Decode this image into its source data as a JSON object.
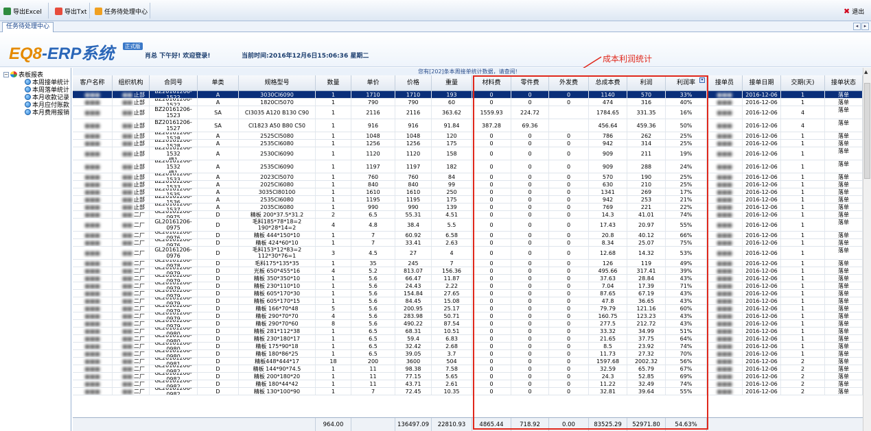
{
  "toolbar": {
    "export_excel": "导出Excel",
    "export_txt": "导出Txt",
    "task_center": "任务待处理中心",
    "exit": "退出"
  },
  "tab": {
    "label": "任务待处理中心"
  },
  "header": {
    "logo_a": "EQ8",
    "logo_b": "-ERP系统",
    "badge": "正式版",
    "greeting": "肖总 下午好! 欢迎登录!",
    "time": "当前时间:2016年12月6日15:06:36 星期二"
  },
  "annotation": "成本利润统计",
  "tree": {
    "root": "表板报表",
    "items": [
      "本周接单统计",
      "本周落单统计",
      "本月收款记录",
      "本月应付账款",
      "本月费用报销"
    ]
  },
  "grid": {
    "info": "您有[202]条本周接单统计数据，请查阅!",
    "columns": [
      "客户名称",
      "组织机构",
      "合同号",
      "单类",
      "规格型号",
      "数量",
      "单价",
      "价格",
      "重量",
      "材料费",
      "零件费",
      "外发费",
      "总成本费",
      "利润",
      "利润率",
      "接单员",
      "接单日期",
      "交期(天)",
      "接单状态"
    ],
    "rows": [
      [
        "",
        "止部",
        "BZ20161206-1522",
        "A",
        "3030CI6090",
        "1",
        "1710",
        "1710",
        "193",
        "0",
        "0",
        "0",
        "1140",
        "570",
        "33%",
        "",
        "2016-12-06",
        "1",
        "落单"
      ],
      [
        "",
        "止部",
        "BZ20161206-1522",
        "A",
        "1820CI5070",
        "1",
        "790",
        "790",
        "60",
        "0",
        "0",
        "0",
        "474",
        "316",
        "40%",
        "",
        "2016-12-06",
        "1",
        "落单"
      ],
      [
        "",
        "止部",
        "BZ20161206-1523",
        "SA",
        "CI3035 A120 B130 C90",
        "1",
        "2116",
        "2116",
        "363.62",
        "1559.93",
        "224.72",
        "",
        "1784.65",
        "331.35",
        "16%",
        "",
        "2016-12-06",
        "4",
        "落单"
      ],
      [
        "",
        "止部",
        "BZ20161206-1527",
        "SA",
        "CI1823 A50 B80 C50",
        "1",
        "916",
        "916",
        "91.84",
        "387.28",
        "69.36",
        "",
        "456.64",
        "459.36",
        "50%",
        "",
        "2016-12-06",
        "4",
        "落单"
      ],
      [
        "",
        "止部",
        "BZ20161206-1528",
        "A",
        "2525CI5080",
        "1",
        "1048",
        "1048",
        "120",
        "0",
        "0",
        "0",
        "786",
        "262",
        "25%",
        "",
        "2016-12-06",
        "1",
        "落单"
      ],
      [
        "",
        "止部",
        "BZ20161206-1528",
        "A",
        "2535CI6080",
        "1",
        "1256",
        "1256",
        "175",
        "0",
        "0",
        "0",
        "942",
        "314",
        "25%",
        "",
        "2016-12-06",
        "1",
        "落单"
      ],
      [
        "",
        "止部",
        "BZ20161206-1532\n修1",
        "A",
        "2530CI6090",
        "1",
        "1120",
        "1120",
        "158",
        "0",
        "0",
        "0",
        "909",
        "211",
        "19%",
        "",
        "2016-12-06",
        "1",
        "落单"
      ],
      [
        "",
        "止部",
        "BZ20161206-1532\n修1",
        "A",
        "2535CI6090",
        "1",
        "1197",
        "1197",
        "182",
        "0",
        "0",
        "0",
        "909",
        "288",
        "24%",
        "",
        "2016-12-06",
        "1",
        "落单"
      ],
      [
        "",
        "止部",
        "BZ20161206-1533",
        "A",
        "2023CI5070",
        "1",
        "760",
        "760",
        "84",
        "0",
        "0",
        "0",
        "570",
        "190",
        "25%",
        "",
        "2016-12-06",
        "1",
        "落单"
      ],
      [
        "",
        "止部",
        "BZ20161206-1533",
        "A",
        "2025CI6080",
        "1",
        "840",
        "840",
        "99",
        "0",
        "0",
        "0",
        "630",
        "210",
        "25%",
        "",
        "2016-12-06",
        "1",
        "落单"
      ],
      [
        "",
        "止部",
        "BZ20161206-1535",
        "A",
        "3035CI80100",
        "1",
        "1610",
        "1610",
        "250",
        "0",
        "0",
        "0",
        "1341",
        "269",
        "17%",
        "",
        "2016-12-06",
        "1",
        "落单"
      ],
      [
        "",
        "止部",
        "BZ20161206-1536",
        "A",
        "2535CI6080",
        "1",
        "1195",
        "1195",
        "175",
        "0",
        "0",
        "0",
        "942",
        "253",
        "21%",
        "",
        "2016-12-06",
        "1",
        "落单"
      ],
      [
        "",
        "止部",
        "BZ20161206-1537",
        "A",
        "2035CI6080",
        "1",
        "990",
        "990",
        "139",
        "0",
        "0",
        "0",
        "769",
        "221",
        "22%",
        "",
        "2016-12-06",
        "1",
        "落单"
      ],
      [
        "",
        "二厂",
        "GL20161206-0975",
        "D",
        "精板 200*37.5*31.2",
        "2",
        "6.5",
        "55.31",
        "4.51",
        "0",
        "0",
        "0",
        "14.3",
        "41.01",
        "74%",
        "",
        "2016-12-06",
        "1",
        "落单"
      ],
      [
        "",
        "二厂",
        "GL20161206-0975",
        "D",
        "毛料185*78*18=2\n190*28*14=2",
        "4",
        "4.8",
        "38.4",
        "5.5",
        "0",
        "0",
        "0",
        "17.43",
        "20.97",
        "55%",
        "",
        "2016-12-06",
        "1",
        "落单"
      ],
      [
        "",
        "二厂",
        "GL20161206-0976",
        "D",
        "精板 444*150*10",
        "1",
        "7",
        "60.92",
        "6.58",
        "0",
        "0",
        "0",
        "20.8",
        "40.12",
        "66%",
        "",
        "2016-12-06",
        "1",
        "落单"
      ],
      [
        "",
        "二厂",
        "GL20161206-0976",
        "D",
        "精板 424*60*10",
        "1",
        "7",
        "33.41",
        "2.63",
        "0",
        "0",
        "0",
        "8.34",
        "25.07",
        "75%",
        "",
        "2016-12-06",
        "1",
        "落单"
      ],
      [
        "",
        "二厂",
        "GL20161206-0976",
        "D",
        "毛料153*12*83=2\n112*30*76=1",
        "3",
        "4.5",
        "27",
        "4",
        "0",
        "0",
        "0",
        "12.68",
        "14.32",
        "53%",
        "",
        "2016-12-06",
        "1",
        "落单"
      ],
      [
        "",
        "二厂",
        "GL20161206-0978",
        "D",
        "毛料175*135*35",
        "1",
        "35",
        "245",
        "7",
        "0",
        "0",
        "0",
        "126",
        "119",
        "49%",
        "",
        "2016-12-06",
        "1",
        "落单"
      ],
      [
        "",
        "二厂",
        "GL20161206-0979",
        "D",
        "光板 650*455*16",
        "4",
        "5.2",
        "813.07",
        "156.36",
        "0",
        "0",
        "0",
        "495.66",
        "317.41",
        "39%",
        "",
        "2016-12-06",
        "1",
        "落单"
      ],
      [
        "",
        "二厂",
        "GL20161206-0979",
        "D",
        "精板 350*350*10",
        "1",
        "5.6",
        "66.47",
        "11.87",
        "0",
        "0",
        "0",
        "37.63",
        "28.84",
        "43%",
        "",
        "2016-12-06",
        "1",
        "落单"
      ],
      [
        "",
        "二厂",
        "GL20161206-0979",
        "D",
        "精板 230*110*10",
        "1",
        "5.6",
        "24.43",
        "2.22",
        "0",
        "0",
        "0",
        "7.04",
        "17.39",
        "71%",
        "",
        "2016-12-06",
        "1",
        "落单"
      ],
      [
        "",
        "二厂",
        "GL20161206-0979",
        "D",
        "精板 605*170*30",
        "1",
        "5.6",
        "154.84",
        "27.65",
        "0",
        "0",
        "0",
        "87.65",
        "67.19",
        "43%",
        "",
        "2016-12-06",
        "1",
        "落单"
      ],
      [
        "",
        "二厂",
        "GL20161206-0979",
        "D",
        "精板 605*170*15",
        "1",
        "5.6",
        "84.45",
        "15.08",
        "0",
        "0",
        "0",
        "47.8",
        "36.65",
        "43%",
        "",
        "2016-12-06",
        "1",
        "落单"
      ],
      [
        "",
        "二厂",
        "GL20161206-0979",
        "D",
        "精板 166*70*48",
        "5",
        "5.6",
        "200.95",
        "25.17",
        "0",
        "0",
        "0",
        "79.79",
        "121.16",
        "60%",
        "",
        "2016-12-06",
        "1",
        "落单"
      ],
      [
        "",
        "二厂",
        "GL20161206-0979",
        "D",
        "精板 290*70*70",
        "4",
        "5.6",
        "283.98",
        "50.71",
        "0",
        "0",
        "0",
        "160.75",
        "123.23",
        "43%",
        "",
        "2016-12-06",
        "1",
        "落单"
      ],
      [
        "",
        "二厂",
        "GL20161206-0979",
        "D",
        "精板 290*70*60",
        "8",
        "5.6",
        "490.22",
        "87.54",
        "0",
        "0",
        "0",
        "277.5",
        "212.72",
        "43%",
        "",
        "2016-12-06",
        "1",
        "落单"
      ],
      [
        "",
        "二厂",
        "GL20161206-0980",
        "D",
        "精板 281*112*38",
        "1",
        "6.5",
        "68.31",
        "10.51",
        "0",
        "0",
        "0",
        "33.32",
        "34.99",
        "51%",
        "",
        "2016-12-06",
        "1",
        "落单"
      ],
      [
        "",
        "二厂",
        "GL20161206-0980",
        "D",
        "精板 230*180*17",
        "1",
        "6.5",
        "59.4",
        "6.83",
        "0",
        "0",
        "0",
        "21.65",
        "37.75",
        "64%",
        "",
        "2016-12-06",
        "1",
        "落单"
      ],
      [
        "",
        "二厂",
        "GL20161206-0980",
        "D",
        "精板 175*90*18",
        "1",
        "6.5",
        "32.42",
        "2.68",
        "0",
        "0",
        "0",
        "8.5",
        "23.92",
        "74%",
        "",
        "2016-12-06",
        "1",
        "落单"
      ],
      [
        "",
        "二厂",
        "GL20161206-0980",
        "D",
        "精板 180*86*25",
        "1",
        "6.5",
        "39.05",
        "3.7",
        "0",
        "0",
        "0",
        "11.73",
        "27.32",
        "70%",
        "",
        "2016-12-06",
        "1",
        "落单"
      ],
      [
        "",
        "二厂",
        "GL20161206-0981",
        "D",
        "精板448*444*17",
        "18",
        "200",
        "3600",
        "504",
        "0",
        "0",
        "0",
        "1597.68",
        "2002.32",
        "56%",
        "",
        "2016-12-06",
        "2",
        "落单"
      ],
      [
        "",
        "二厂",
        "GL20161206-0982",
        "D",
        "精板 144*90*74.5",
        "1",
        "11",
        "98.38",
        "7.58",
        "0",
        "0",
        "0",
        "32.59",
        "65.79",
        "67%",
        "",
        "2016-12-06",
        "2",
        "落单"
      ],
      [
        "",
        "二厂",
        "GL20161206-0982",
        "D",
        "精板 200*180*20",
        "1",
        "11",
        "77.15",
        "5.65",
        "0",
        "0",
        "0",
        "24.3",
        "52.85",
        "69%",
        "",
        "2016-12-06",
        "2",
        "落单"
      ],
      [
        "",
        "二厂",
        "GL20161206-0982",
        "D",
        "精板 180*44*42",
        "1",
        "11",
        "43.71",
        "2.61",
        "0",
        "0",
        "0",
        "11.22",
        "32.49",
        "74%",
        "",
        "2016-12-06",
        "2",
        "落单"
      ],
      [
        "",
        "二厂",
        "GL20161206-0982",
        "D",
        "精板 130*100*90",
        "1",
        "7",
        "72.45",
        "10.35",
        "0",
        "0",
        "0",
        "32.81",
        "39.64",
        "55%",
        "",
        "2016-12-06",
        "2",
        "落单"
      ]
    ],
    "totals": {
      "qty": "964.00",
      "price": "136497.09",
      "weight": "22810.93",
      "material": "4865.44",
      "parts": "718.92",
      "outsource": "0.00",
      "total_cost": "83525.29",
      "profit": "52971.80",
      "margin": "54.63%"
    }
  },
  "colors": {
    "accent": "#e0271b",
    "selected_row": "#0a2f7a",
    "brand_orange": "#e58a00",
    "brand_blue": "#2a66b8"
  }
}
